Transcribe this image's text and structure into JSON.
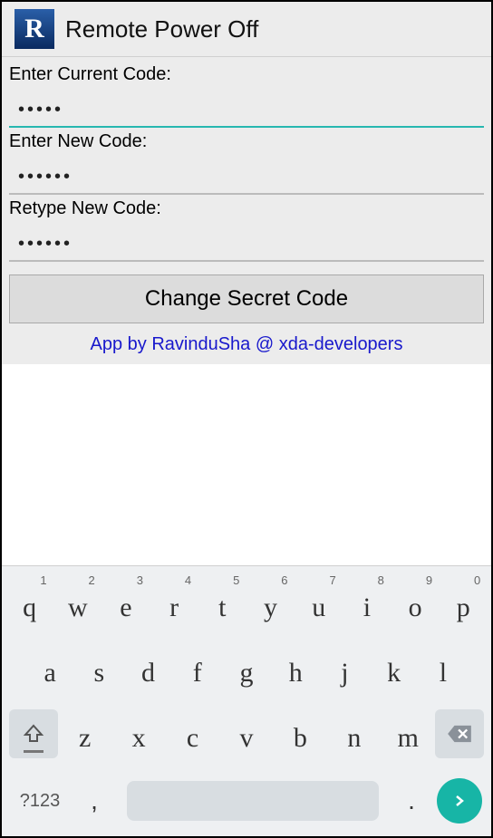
{
  "app": {
    "icon_letter": "R",
    "title": "Remote Power Off"
  },
  "form": {
    "current": {
      "label": "Enter Current Code:",
      "value": "•••••"
    },
    "new": {
      "label": "Enter New Code:",
      "value": "••••••"
    },
    "retype": {
      "label": "Retype New Code:",
      "value": "••••••"
    },
    "button": "Change Secret Code",
    "credit": "App by RavinduSha @ xda-developers"
  },
  "keyboard": {
    "row1": [
      {
        "k": "q",
        "n": "1"
      },
      {
        "k": "w",
        "n": "2"
      },
      {
        "k": "e",
        "n": "3"
      },
      {
        "k": "r",
        "n": "4"
      },
      {
        "k": "t",
        "n": "5"
      },
      {
        "k": "y",
        "n": "6"
      },
      {
        "k": "u",
        "n": "7"
      },
      {
        "k": "i",
        "n": "8"
      },
      {
        "k": "o",
        "n": "9"
      },
      {
        "k": "p",
        "n": "0"
      }
    ],
    "row2": [
      "a",
      "s",
      "d",
      "f",
      "g",
      "h",
      "j",
      "k",
      "l"
    ],
    "row3": [
      "z",
      "x",
      "c",
      "v",
      "b",
      "n",
      "m"
    ],
    "sym": "?123",
    "comma": ",",
    "period": "."
  }
}
